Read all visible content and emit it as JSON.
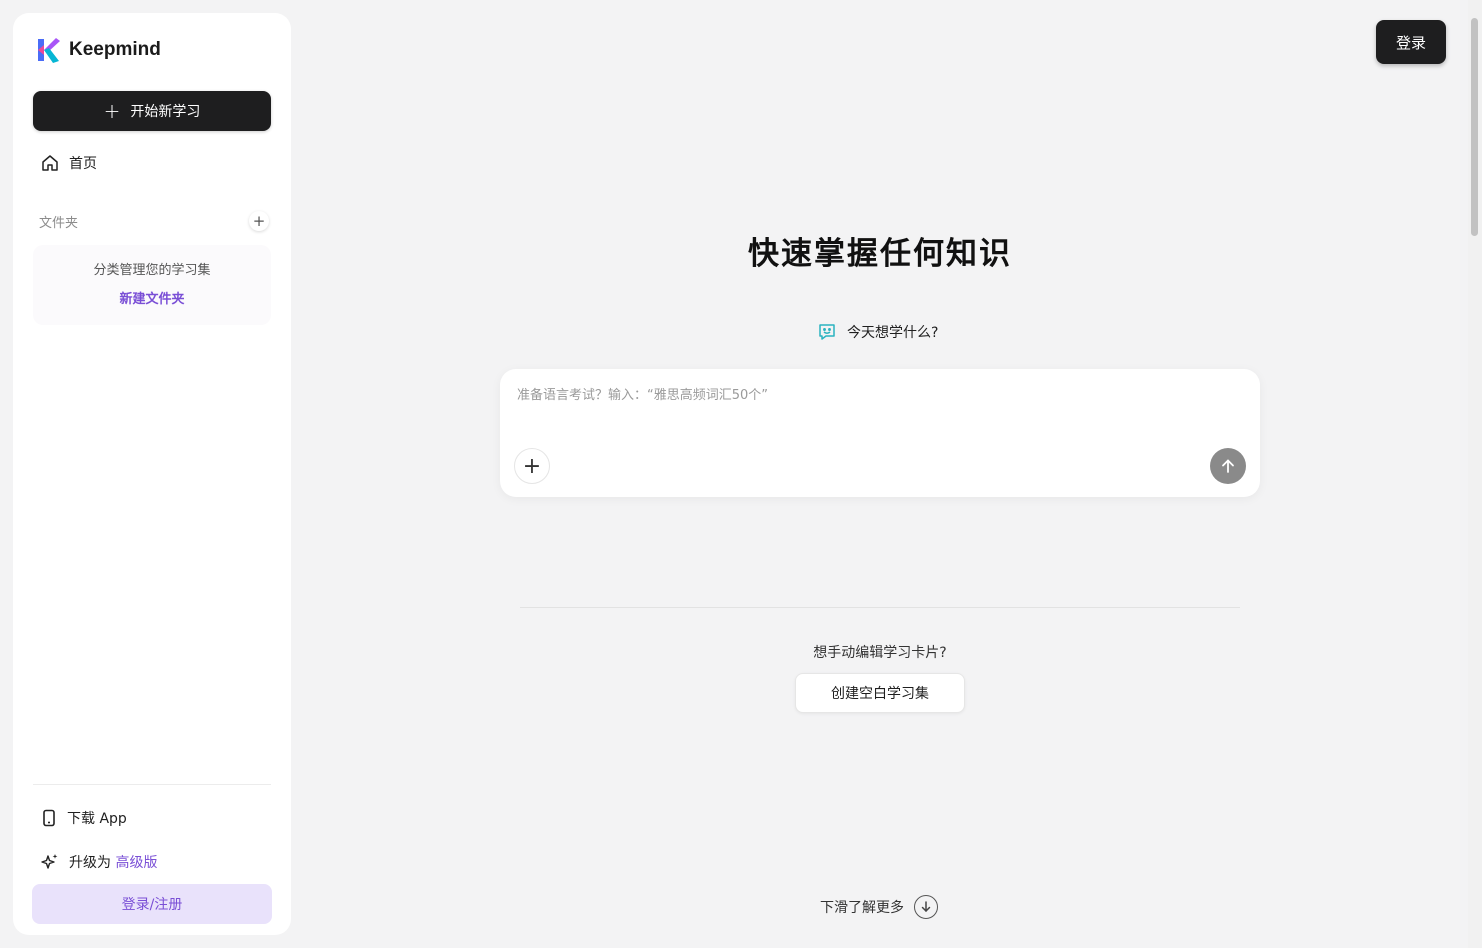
{
  "brand": {
    "name": "Keepmind"
  },
  "sidebar": {
    "new_study_label": "开始新学习",
    "home_label": "首页",
    "folder_section_label": "文件夹",
    "folder_empty_desc": "分类管理您的学习集",
    "new_folder_label": "新建文件夹",
    "download_app_label": "下载 App",
    "upgrade_prefix": "升级为",
    "upgrade_highlight": "高级版",
    "login_register_label": "登录/注册"
  },
  "header": {
    "login_label": "登录"
  },
  "main": {
    "headline": "快速掌握任何知识",
    "prompt_question": "今天想学什么?",
    "input_placeholder": "准备语言考试？输入：“雅思高频词汇50个”",
    "manual_question": "想手动编辑学习卡片?",
    "create_blank_label": "创建空白学习集",
    "scroll_more_label": "下滑了解更多"
  },
  "colors": {
    "accent": "#7a4fd6",
    "dark_button": "#1e1e1f",
    "login_reg_bg": "#e9e2fb"
  },
  "icons": {
    "logo": "keepmind-logo",
    "home": "home-icon",
    "plus": "plus-icon",
    "chat": "chat-smile-icon",
    "send": "arrow-up-icon",
    "phone": "phone-icon",
    "sparkle": "sparkle-icon",
    "down": "arrow-down-circle-icon"
  }
}
